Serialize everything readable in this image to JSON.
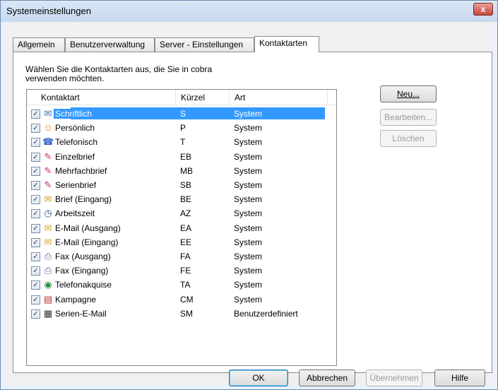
{
  "window": {
    "title": "Systemeinstellungen",
    "close_label": "x"
  },
  "tabs": [
    "Allgemein",
    "Benutzerverwaltung",
    "Server - Einstellungen",
    "Kontaktarten"
  ],
  "intro": "Wählen Sie die Kontaktarten aus, die Sie in cobra verwenden möchten.",
  "columns": {
    "name": "Kontaktart",
    "short": "Kürzel",
    "type": "Art"
  },
  "rows": [
    {
      "name": "Schriftlich",
      "short": "S",
      "type": "System",
      "icon": "letter-icon"
    },
    {
      "name": "Persönlich",
      "short": "P",
      "type": "System",
      "icon": "person-icon"
    },
    {
      "name": "Telefonisch",
      "short": "T",
      "type": "System",
      "icon": "phone-icon"
    },
    {
      "name": "Einzelbrief",
      "short": "EB",
      "type": "System",
      "icon": "single-letter-icon"
    },
    {
      "name": "Mehrfachbrief",
      "short": "MB",
      "type": "System",
      "icon": "multi-letter-icon"
    },
    {
      "name": "Serienbrief",
      "short": "SB",
      "type": "System",
      "icon": "serial-letter-icon"
    },
    {
      "name": "Brief (Eingang)",
      "short": "BE",
      "type": "System",
      "icon": "incoming-letter-icon"
    },
    {
      "name": "Arbeitszeit",
      "short": "AZ",
      "type": "System",
      "icon": "clock-icon"
    },
    {
      "name": "E-Mail (Ausgang)",
      "short": "EA",
      "type": "System",
      "icon": "outgoing-mail-icon"
    },
    {
      "name": "E-Mail (Eingang)",
      "short": "EE",
      "type": "System",
      "icon": "incoming-mail-icon"
    },
    {
      "name": "Fax (Ausgang)",
      "short": "FA",
      "type": "System",
      "icon": "outgoing-fax-icon"
    },
    {
      "name": "Fax (Eingang)",
      "short": "FE",
      "type": "System",
      "icon": "incoming-fax-icon"
    },
    {
      "name": "Telefonakquise",
      "short": "TA",
      "type": "System",
      "icon": "globe-phone-icon"
    },
    {
      "name": "Kampagne",
      "short": "CM",
      "type": "System",
      "icon": "campaign-icon"
    },
    {
      "name": "Serien-E-Mail",
      "short": "SM",
      "type": "Benutzerdefiniert",
      "icon": "serial-mail-icon"
    }
  ],
  "side_buttons": {
    "new": "Neu...",
    "edit": "Bearbeiten...",
    "delete": "Löschen"
  },
  "footer_buttons": {
    "ok": "OK",
    "cancel": "Abbrechen",
    "apply": "Übernehmen",
    "help": "Hilfe"
  }
}
